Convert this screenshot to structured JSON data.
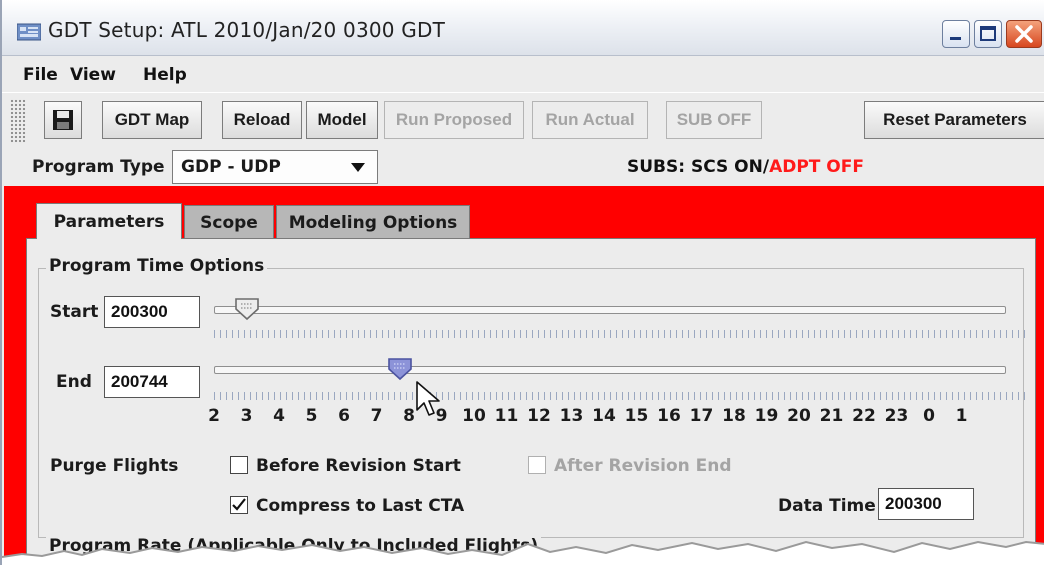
{
  "window": {
    "title": "GDT Setup: ATL 2010/Jan/20 0300 GDT",
    "buttons": [
      "minimize",
      "maximize",
      "close"
    ]
  },
  "menubar": {
    "items": [
      {
        "label": "File"
      },
      {
        "label": "View"
      },
      {
        "label": "Help"
      }
    ]
  },
  "toolbar": {
    "save_icon": "floppy-disk-icon",
    "gdt_map": "GDT Map",
    "reload": "Reload",
    "model": "Model",
    "run_proposed": "Run Proposed",
    "run_actual": "Run Actual",
    "sub_off": "SUB OFF",
    "reset_parameters": "Reset Parameters"
  },
  "program": {
    "type_label": "Program Type",
    "type_value": "GDP - UDP",
    "subs_prefix": "SUBS: SCS ON/",
    "subs_suffix": "ADPT OFF"
  },
  "tabs": [
    {
      "label": "Parameters",
      "active": true
    },
    {
      "label": "Scope",
      "active": false
    },
    {
      "label": "Modeling Options",
      "active": false
    }
  ],
  "time_options": {
    "title": "Program Time Options",
    "start_label": "Start",
    "start_value": "200300",
    "end_label": "End",
    "end_value": "200744",
    "hour_labels": [
      "2",
      "3",
      "4",
      "5",
      "6",
      "7",
      "8",
      "9",
      "10",
      "11",
      "12",
      "13",
      "14",
      "15",
      "16",
      "17",
      "18",
      "19",
      "20",
      "21",
      "22",
      "23",
      "0",
      "1"
    ],
    "start_slider_hour": 3.0,
    "end_slider_hour": 7.73,
    "purge_label": "Purge Flights",
    "before_revision_start": {
      "label": "Before Revision Start",
      "checked": false,
      "enabled": true
    },
    "after_revision_end": {
      "label": "After Revision End",
      "checked": false,
      "enabled": false
    },
    "compress": {
      "label": "Compress to Last CTA",
      "checked": true,
      "enabled": true
    },
    "data_time_label": "Data Time",
    "data_time_value": "200300"
  },
  "program_rate": {
    "title": "Program Rate (Applicable Only to Included Flights)"
  },
  "colors": {
    "red_background": "#ff0000",
    "adpt_off": "#ff1a1a",
    "end_thumb": "#8c93d8"
  }
}
